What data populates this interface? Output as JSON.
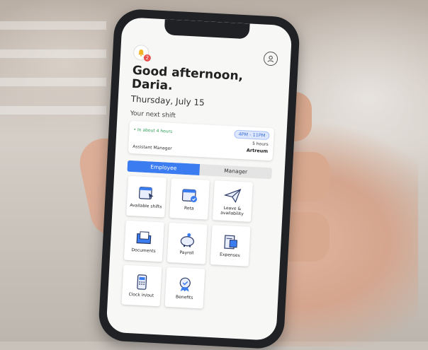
{
  "header": {
    "notification_count": "2",
    "greeting": "Good afternoon, Daria.",
    "date": "Thursday, July 15"
  },
  "next_shift": {
    "section_label": "Your next shift",
    "starts_in": "• In about 4 hours",
    "time_range": "4PM - 11PM",
    "duration": "5 hours",
    "role": "Assistant Manager",
    "location": "Artreum"
  },
  "toggle": {
    "employee_label": "Employee",
    "manager_label": "Manager",
    "selected": "Employee"
  },
  "tiles": [
    {
      "label": "Available shifts",
      "icon": "calendar-pointer-icon"
    },
    {
      "label": "Rota",
      "icon": "calendar-check-icon"
    },
    {
      "label": "Leave & availability",
      "icon": "paper-plane-icon"
    },
    {
      "label": "Documents",
      "icon": "folder-icon"
    },
    {
      "label": "Payroll",
      "icon": "piggy-bank-icon"
    },
    {
      "label": "Expenses",
      "icon": "receipt-icon"
    },
    {
      "label": "Clock in/out",
      "icon": "keypad-phone-icon"
    },
    {
      "label": "Benefits",
      "icon": "award-badge-icon"
    }
  ],
  "colors": {
    "accent": "#3b7df0",
    "success": "#2a9d55",
    "badge": "#e8504b"
  }
}
